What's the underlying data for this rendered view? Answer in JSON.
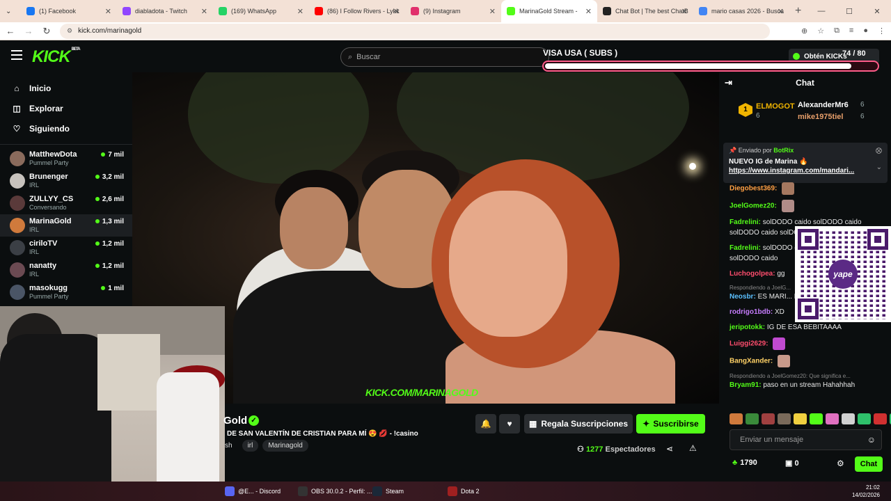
{
  "browser": {
    "tabs": [
      {
        "label": "(1) Facebook",
        "color": "#1877f2"
      },
      {
        "label": "diabladota - Twitch",
        "color": "#9146ff"
      },
      {
        "label": "(169) WhatsApp",
        "color": "#25d366"
      },
      {
        "label": "(86) I Follow Rivers - Lykk",
        "color": "#ff0000"
      },
      {
        "label": "(9) Instagram",
        "color": "#e1306c"
      },
      {
        "label": "MarinaGold Stream -",
        "color": "#53fc18"
      },
      {
        "label": "Chat Bot | The best ChatB",
        "color": "#222222"
      },
      {
        "label": "mario casas 2026 - Busca",
        "color": "#4285f4"
      }
    ],
    "url": "kick.com/marinagold"
  },
  "header": {
    "logo": "KICK",
    "logo_sup": "BETA",
    "search_placeholder": "Buscar",
    "kicks_label": "Obtén KICKs"
  },
  "overlay": {
    "goal_label": "VISA USA ( SUBS )",
    "current": "74",
    "total": "/ 80",
    "progress": 0.925
  },
  "sidebar": {
    "nav": [
      {
        "label": "Inicio",
        "icon": "home-icon",
        "glyph": "⌂"
      },
      {
        "label": "Explorar",
        "icon": "compass-icon",
        "glyph": "◫"
      },
      {
        "label": "Siguiendo",
        "icon": "heart-icon",
        "glyph": "♡"
      }
    ],
    "channels": [
      {
        "name": "MatthewDota",
        "category": "Pummel Party",
        "viewers": "7 mil",
        "color": "#8a6b5c"
      },
      {
        "name": "Brunenger",
        "category": "IRL",
        "viewers": "3,2 mil",
        "color": "#c7c2bd"
      },
      {
        "name": "ZULLYY_CS",
        "category": "Conversando",
        "viewers": "2,6 mil",
        "color": "#5a3a3a"
      },
      {
        "name": "MarinaGold",
        "category": "IRL",
        "viewers": "1,3 mil",
        "color": "#d07a3c"
      },
      {
        "name": "ciriloTV",
        "category": "IRL",
        "viewers": "1,2 mil",
        "color": "#3b3f45"
      },
      {
        "name": "nanatty",
        "category": "IRL",
        "viewers": "1,2 mil",
        "color": "#6b4a52"
      },
      {
        "name": "masokugg",
        "category": "Pummel Party",
        "viewers": "1 mil",
        "color": "#4a5566"
      }
    ]
  },
  "video": {
    "watermark": "KICK.COM/MARINAGOLD"
  },
  "stream": {
    "name": "Gold",
    "title": "DE SAN VALENTÍN DE CRISTIAN PARA MÍ 😍 💋 - !casino",
    "tags": [
      "sh",
      "irl",
      "Marinagold"
    ],
    "regala_label": "Regala Suscripciones",
    "subscribe_label": "Suscribirse",
    "viewers_count": "1277",
    "viewers_label": "Espectadores"
  },
  "chat": {
    "title": "Chat",
    "top": [
      {
        "rank": "1",
        "name": "ELMOGOT",
        "count": "6"
      },
      {
        "name": "AlexanderMr6",
        "count": "6"
      },
      {
        "name": "mike1975tiel",
        "count": "6"
      }
    ],
    "pinned": {
      "sent_by": "Enviado por",
      "bot": "BotRix",
      "message": "NUEVO IG de Marina 🔥",
      "link": "https://www.instagram.com/mandari..."
    },
    "messages": [
      {
        "user": "Diegobest369:",
        "text": "",
        "color": "#ff9f43",
        "emote": "#a57860"
      },
      {
        "user": "JoelGomez20:",
        "text": "",
        "color": "#53fc18",
        "emote": "#b08c88"
      },
      {
        "user": "Fadrelini:",
        "text": "solDODO caido solDODO caido solDODO caido solDODO caido solDODO caido",
        "color": "#53fc18"
      },
      {
        "user": "Fadrelini:",
        "text": "solDODO caido solDODO caido solDODO caido",
        "color": "#53fc18"
      },
      {
        "user": "Luchogolpea:",
        "text": "gg",
        "color": "#ff4d6d"
      },
      {
        "reply": "Respondiendo a JoelG...",
        "user": "Neosbr:",
        "text": "ES MARI... DE MARINO O SEA H...",
        "color": "#5bc0ff"
      },
      {
        "user": "rodrigo1bdb:",
        "text": "XD",
        "color": "#c77dff"
      },
      {
        "user": "jeripotokk:",
        "text": "IG DE ESA BEBITAAAA",
        "color": "#53fc18"
      },
      {
        "user": "Luiggi2629:",
        "text": "",
        "color": "#ff4d6d",
        "emote": "#c04ad0"
      },
      {
        "user": "BangXander:",
        "text": "",
        "color": "#ffd166",
        "emote": "#c89a8a"
      },
      {
        "reply": "Respondiendo a JoelGomez20: Que significa e...",
        "user": "Bryam91:",
        "text": "paso en un stream Hahahhah",
        "color": "#53fc18"
      }
    ],
    "input_placeholder": "Enviar un mensaje",
    "points": "1790",
    "kicks": "0",
    "chat_button": "Chat"
  },
  "taskbar": {
    "items": [
      {
        "label": "@E... - Discord",
        "color": "#5865f2"
      },
      {
        "label": "OBS 30.0.2 - Perfil: ...",
        "color": "#333333"
      },
      {
        "label": "Steam",
        "color": "#1b2838"
      },
      {
        "label": "Dota 2",
        "color": "#a02020"
      }
    ],
    "time": "21:02",
    "date": "14/02/2026"
  }
}
